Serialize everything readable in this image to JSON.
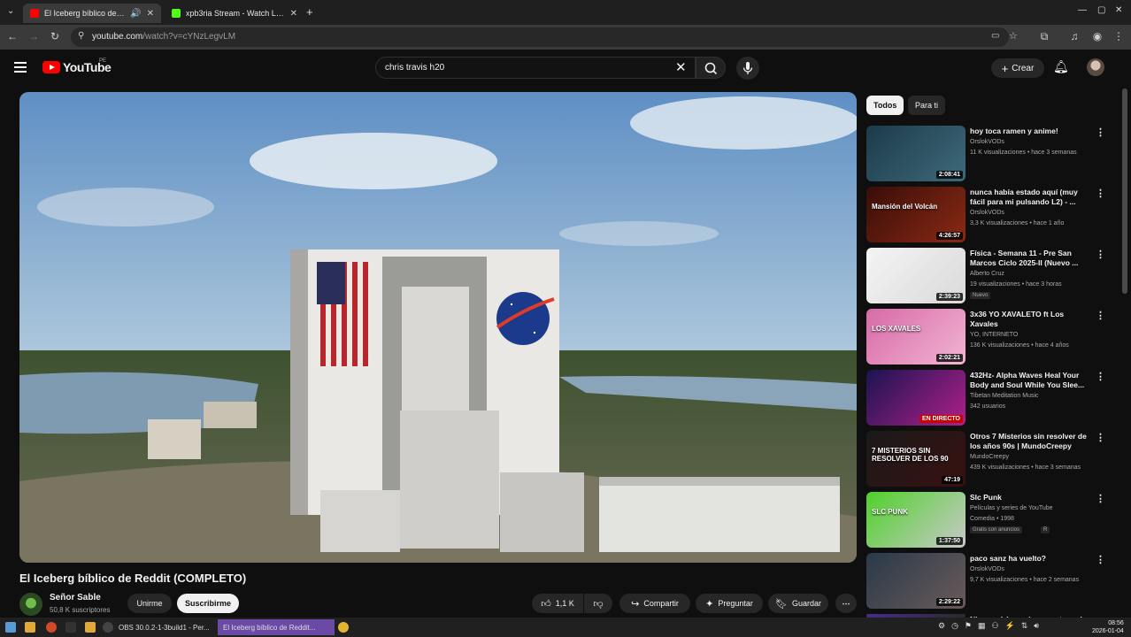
{
  "browser": {
    "tabs": [
      {
        "title": "El Iceberg bíblico de Redd",
        "active": true,
        "favicon_color": "#ff0000"
      },
      {
        "title": "xpb3ria Stream - Watch Live",
        "active": false,
        "favicon_color": "#53fc18"
      }
    ],
    "url_host": "youtube.com",
    "url_path": "/watch?v=cYNzLegvLM"
  },
  "youtube": {
    "logo_text": "YouTube",
    "country_code": "PE",
    "search_value": "chris travis h20",
    "create_label": "Crear"
  },
  "video": {
    "title": "El Iceberg bíblico de Reddit (COMPLETO)",
    "channel": "Señor Sable",
    "subscribers": "50,8 K suscriptores",
    "join_label": "Unirme",
    "subscribe_label": "Suscribirme",
    "likes": "1,1 K",
    "share_label": "Compartir",
    "ask_label": "Preguntar",
    "save_label": "Guardar"
  },
  "chips": [
    "Todos",
    "Para ti"
  ],
  "recommendations": [
    {
      "title": "hoy toca ramen y anime!",
      "channel": "OrslokVODs",
      "meta": "11 K visualizaciones • hace 3 semanas",
      "duration": "2:08:41",
      "thumb_colors": [
        "#1d3b4a",
        "#3e6a7a"
      ]
    },
    {
      "title": "nunca había estado aquí (muy fácil para mi pulsando L2) - ...",
      "channel": "OrslokVODs",
      "meta": "3,3 K visualizaciones • hace 1 año",
      "duration": "4:26:57",
      "thumb_colors": [
        "#3a0d08",
        "#8a2a14"
      ],
      "thumb_text": "Mansión del Volcán"
    },
    {
      "title": "Física - Semana 11 - Pre San Marcos Ciclo 2025-II (Nuevo ...",
      "channel": "Alberto Cruz",
      "meta": "19 visualizaciones • hace 3 horas",
      "duration": "2:39:23",
      "badge": "Nuevo",
      "thumb_colors": [
        "#f4f4f4",
        "#d9d9d9"
      ]
    },
    {
      "title": "3x36 YO XAVALETO ft Los Xavales",
      "channel": "YO, INTERNETO",
      "meta": "136 K visualizaciones • hace 4 años",
      "duration": "2:02:21",
      "thumb_colors": [
        "#d86aa8",
        "#f1b4d2"
      ],
      "thumb_text": "LOS XAVALES"
    },
    {
      "title": "432Hz- Alpha Waves Heal Your Body and Soul While You Slee...",
      "channel": "Tibetan Meditation Music",
      "meta": "342 usuarios",
      "live_label": "EN DIRECTO",
      "thumb_colors": [
        "#1b1450",
        "#b0208a"
      ]
    },
    {
      "title": "Otros 7 Misterios sin resolver de los años 90s | MundoCreepy",
      "channel": "MundoCreepy",
      "meta": "439 K visualizaciones • hace 3 semanas",
      "duration": "47:19",
      "thumb_colors": [
        "#1a1a1a",
        "#3a1010"
      ],
      "thumb_text": "7 MISTERIOS SIN RESOLVER DE LOS 90"
    },
    {
      "title": "Slc Punk",
      "channel": "Películas y series de YouTube",
      "meta": "Comedia • 1998",
      "duration": "1:37:50",
      "badge": "Gratis con anuncios",
      "badge2": "R",
      "thumb_colors": [
        "#4fd12a",
        "#c9c9c9"
      ],
      "thumb_text": "SLC PUNK"
    },
    {
      "title": "paco sanz ha vuelto?",
      "channel": "OrslokVODs",
      "meta": "9,7 K visualizaciones • hace 2 semanas",
      "duration": "2:29:22",
      "thumb_colors": [
        "#2a3a4a",
        "#6a5a5a"
      ]
    },
    {
      "title": "Ninguna(..)s a mi super stream!",
      "thumb_colors": [
        "#4a2a8a",
        "#2a2a2a"
      ]
    }
  ],
  "taskbar": {
    "windows": [
      "OBS 30.0.2-1-3build1 - Per...",
      "El Iceberg bíblico de Reddit..."
    ],
    "time": "08:56",
    "date": "2026-01-04"
  },
  "colors": {
    "yt_red": "#ff0000",
    "bg": "#0f0f0f",
    "chip_active": "#f1f1f1",
    "live_red": "#cc0000"
  }
}
